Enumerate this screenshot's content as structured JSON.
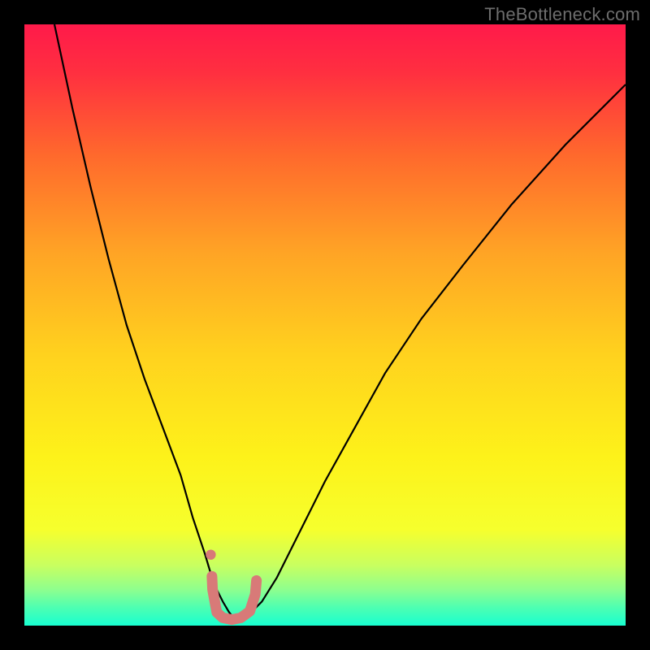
{
  "watermark": "TheBottleneck.com",
  "chart_data": {
    "type": "line",
    "title": "",
    "xlabel": "",
    "ylabel": "",
    "xlim": [
      0,
      100
    ],
    "ylim": [
      0,
      100
    ],
    "background_gradient_stops": [
      {
        "pos": 0.0,
        "color": "#ff1a4a"
      },
      {
        "pos": 0.08,
        "color": "#ff2f40"
      },
      {
        "pos": 0.22,
        "color": "#ff6a2c"
      },
      {
        "pos": 0.38,
        "color": "#ffa425"
      },
      {
        "pos": 0.55,
        "color": "#ffd21e"
      },
      {
        "pos": 0.72,
        "color": "#fdf21a"
      },
      {
        "pos": 0.84,
        "color": "#f6ff2d"
      },
      {
        "pos": 0.9,
        "color": "#c8ff60"
      },
      {
        "pos": 0.94,
        "color": "#8eff8e"
      },
      {
        "pos": 0.97,
        "color": "#4dffb2"
      },
      {
        "pos": 1.0,
        "color": "#18ffd0"
      }
    ],
    "series": [
      {
        "name": "bottleneck-curve",
        "color": "#000000",
        "stroke_width": 2.2,
        "x": [
          5,
          8,
          11,
          14,
          17,
          20,
          23,
          26,
          28,
          30,
          31.5,
          33,
          34,
          35,
          36,
          37.5,
          39.5,
          42,
          45,
          50,
          55,
          60,
          66,
          73,
          81,
          90,
          100
        ],
        "values": [
          100,
          86,
          73,
          61,
          50,
          41,
          33,
          25,
          18,
          12,
          7,
          4,
          2.3,
          1,
          1.2,
          2.0,
          4,
          8,
          14,
          24,
          33,
          42,
          51,
          60,
          70,
          80,
          90
        ]
      },
      {
        "name": "valley-highlight",
        "color": "#d87a78",
        "stroke_width": 13,
        "stroke_linecap": "round",
        "x": [
          31.2,
          31.3,
          32.0,
          33.0,
          34.5,
          36.0,
          37.5,
          38.4,
          38.6
        ],
        "values": [
          8.2,
          6.0,
          2.2,
          1.3,
          1.0,
          1.3,
          2.4,
          5.2,
          7.5
        ]
      },
      {
        "name": "valley-highlight-entry-dot",
        "color": "#d87a78",
        "type": "scatter",
        "marker_radius": 6.2,
        "x": [
          31.0
        ],
        "values": [
          11.8
        ]
      }
    ]
  }
}
